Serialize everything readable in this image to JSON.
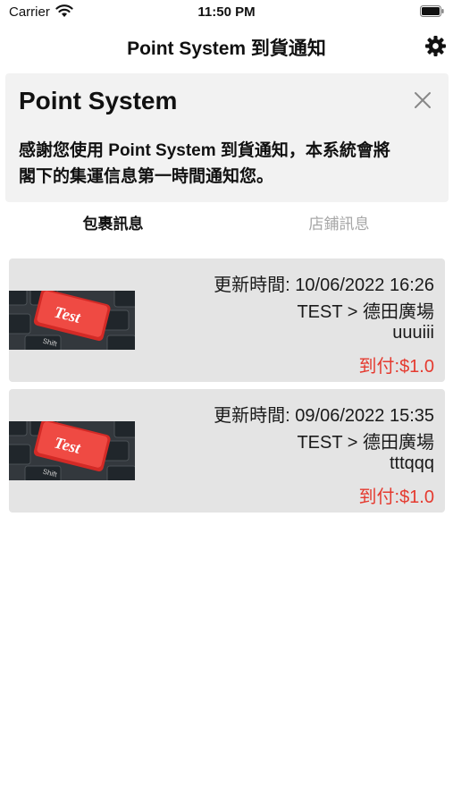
{
  "status_bar": {
    "carrier": "Carrier",
    "time": "11:50 PM"
  },
  "nav": {
    "title": "Point System 到貨通知",
    "settings_icon": "gear-icon"
  },
  "banner": {
    "title": "Point System",
    "message_line1": "感謝您使用 Point System 到貨通知，本系統會將",
    "message_line2": "閣下的集運信息第一時間通知您。",
    "close_icon": "close-icon"
  },
  "tabs": [
    {
      "label": "包裹訊息",
      "active": true
    },
    {
      "label": "店鋪訊息",
      "active": false
    }
  ],
  "items": [
    {
      "thumbnail_text": "Test",
      "updated_label": "更新時間:",
      "updated_time": "10/06/2022 16:26",
      "route": "TEST > 德田廣場",
      "code": "uuuiii",
      "cod_label": "到付:",
      "cod_amount": "$1.0"
    },
    {
      "thumbnail_text": "Test",
      "updated_label": "更新時間:",
      "updated_time": "09/06/2022 15:35",
      "route": "TEST > 德田廣場",
      "code": "tttqqq",
      "cod_label": "到付:",
      "cod_amount": "$1.0"
    }
  ],
  "colors": {
    "accent_red": "#e53a2f",
    "card_bg": "#e4e4e4",
    "banner_bg": "#f2f2f2",
    "inactive_tab": "#a7a7a7"
  }
}
